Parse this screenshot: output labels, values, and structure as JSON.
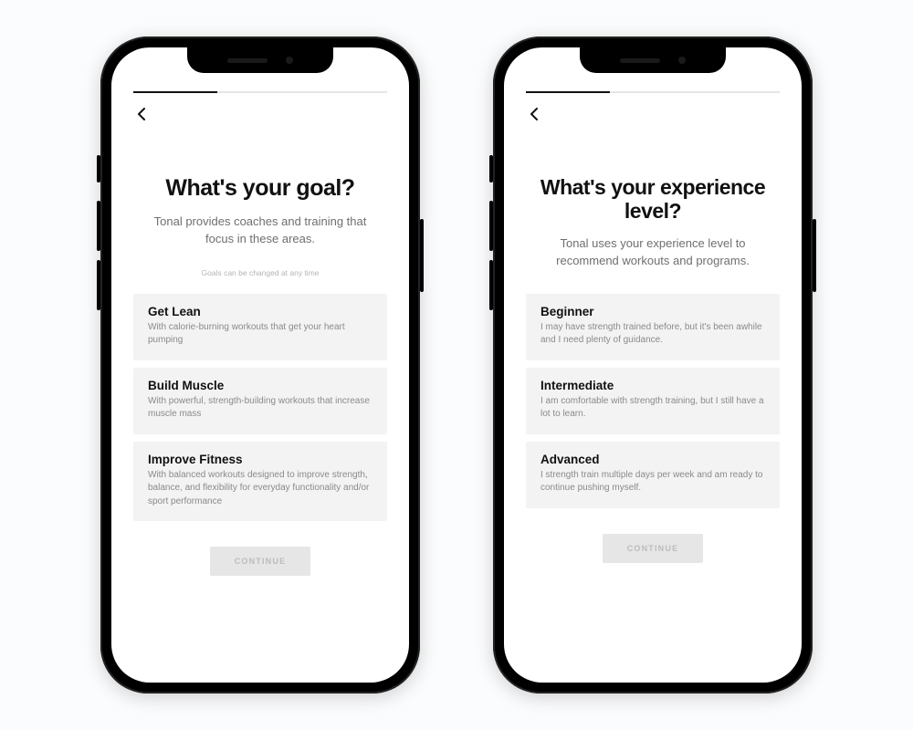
{
  "screens": [
    {
      "progress_pct": 33,
      "heading": "What's your goal?",
      "subheading": "Tonal provides coaches and training that focus in these areas.",
      "hint": "Goals can be changed at any time",
      "options": [
        {
          "title": "Get Lean",
          "desc": "With calorie-burning workouts that get your heart pumping"
        },
        {
          "title": "Build Muscle",
          "desc": "With powerful, strength-building workouts that increase muscle mass"
        },
        {
          "title": "Improve Fitness",
          "desc": "With balanced workouts designed to improve strength, balance, and flexibility for everyday functionality and/or sport performance"
        }
      ],
      "continue_label": "CONTINUE"
    },
    {
      "progress_pct": 33,
      "heading": "What's your experience level?",
      "subheading": "Tonal uses your experience level to recommend workouts and programs.",
      "hint": "",
      "options": [
        {
          "title": "Beginner",
          "desc": "I may have strength trained before, but it's been awhile and I need plenty of guidance."
        },
        {
          "title": "Intermediate",
          "desc": "I am comfortable with strength training, but I still have a lot to learn."
        },
        {
          "title": "Advanced",
          "desc": "I strength train multiple days per week and am ready to continue pushing myself."
        }
      ],
      "continue_label": "CONTINUE"
    }
  ]
}
